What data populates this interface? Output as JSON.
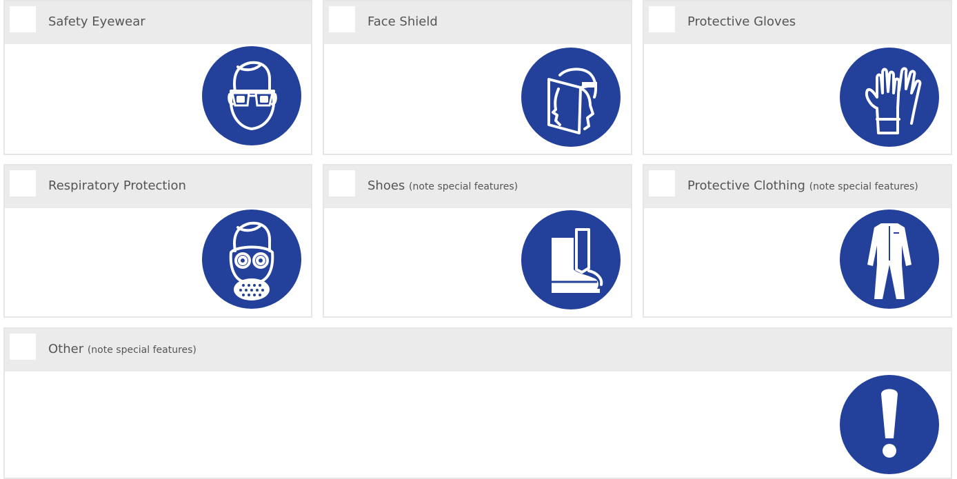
{
  "colors": {
    "header_bg": "#ebebeb",
    "border": "#e6e6e6",
    "badge_blue": "#23409a",
    "text": "#555555"
  },
  "items": [
    {
      "label": "Safety Eyewear",
      "note": "",
      "icon": "safety-eyewear-icon",
      "checked": false
    },
    {
      "label": "Face Shield",
      "note": "",
      "icon": "face-shield-icon",
      "checked": false
    },
    {
      "label": "Protective Gloves",
      "note": "",
      "icon": "protective-gloves-icon",
      "checked": false
    },
    {
      "label": "Respiratory Protection",
      "note": "",
      "icon": "respirator-icon",
      "checked": false
    },
    {
      "label": "Shoes",
      "note": "(note special features)",
      "icon": "safety-boot-icon",
      "checked": false
    },
    {
      "label": "Protective Clothing",
      "note": "(note special features)",
      "icon": "coverall-icon",
      "checked": false
    },
    {
      "label": "Other",
      "note": "(note special features)",
      "icon": "exclamation-icon",
      "checked": false
    }
  ]
}
